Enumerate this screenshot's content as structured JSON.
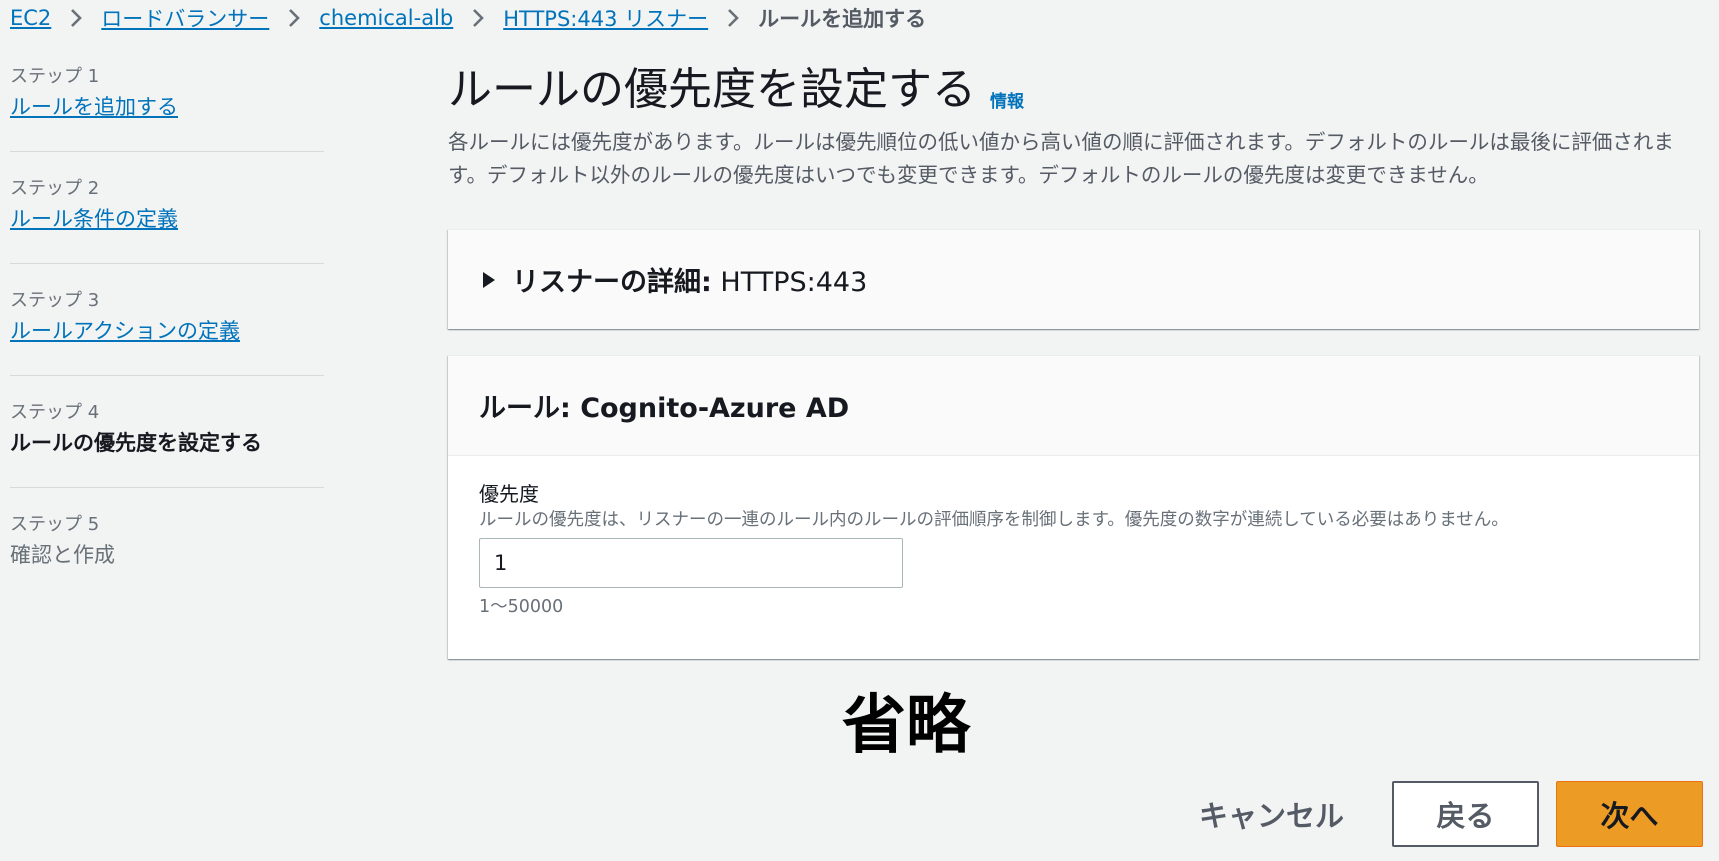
{
  "breadcrumb": {
    "items": [
      "EC2",
      "ロードバランサー",
      "chemical-alb",
      "HTTPS:443 リスナー"
    ],
    "current": "ルールを追加する"
  },
  "steps": [
    {
      "num": "ステップ 1",
      "label": "ルールを追加する",
      "state": "link"
    },
    {
      "num": "ステップ 2",
      "label": "ルール条件の定義",
      "state": "link"
    },
    {
      "num": "ステップ 3",
      "label": "ルールアクションの定義",
      "state": "link"
    },
    {
      "num": "ステップ 4",
      "label": "ルールの優先度を設定する",
      "state": "current"
    },
    {
      "num": "ステップ 5",
      "label": "確認と作成",
      "state": "disabled"
    }
  ],
  "main": {
    "title": "ルールの優先度を設定する",
    "info": "情報",
    "description": "各ルールには優先度があります。ルールは優先順位の低い値から高い値の順に評価されます。デフォルトのルールは最後に評価されます。デフォルト以外のルールの優先度はいつでも変更できます。デフォルトのルールの優先度は変更できません。"
  },
  "listener_panel": {
    "label": "リスナーの詳細:",
    "value": "HTTPS:443"
  },
  "rule_panel": {
    "title": "ルール: Cognito-Azure AD",
    "priority_label": "優先度",
    "priority_desc": "ルールの優先度は、リスナーの一連のルール内のルールの評価順序を制御します。優先度の数字が連続している必要はありません。",
    "priority_value": "1",
    "priority_constraint": "1〜50000"
  },
  "overlay": {
    "omitted": "省略"
  },
  "footer": {
    "cancel": "キャンセル",
    "back": "戻る",
    "next": "次へ"
  },
  "colors": {
    "link": "#0073bb",
    "primary_button": "#ec9c24",
    "background": "#f2f3f3"
  }
}
